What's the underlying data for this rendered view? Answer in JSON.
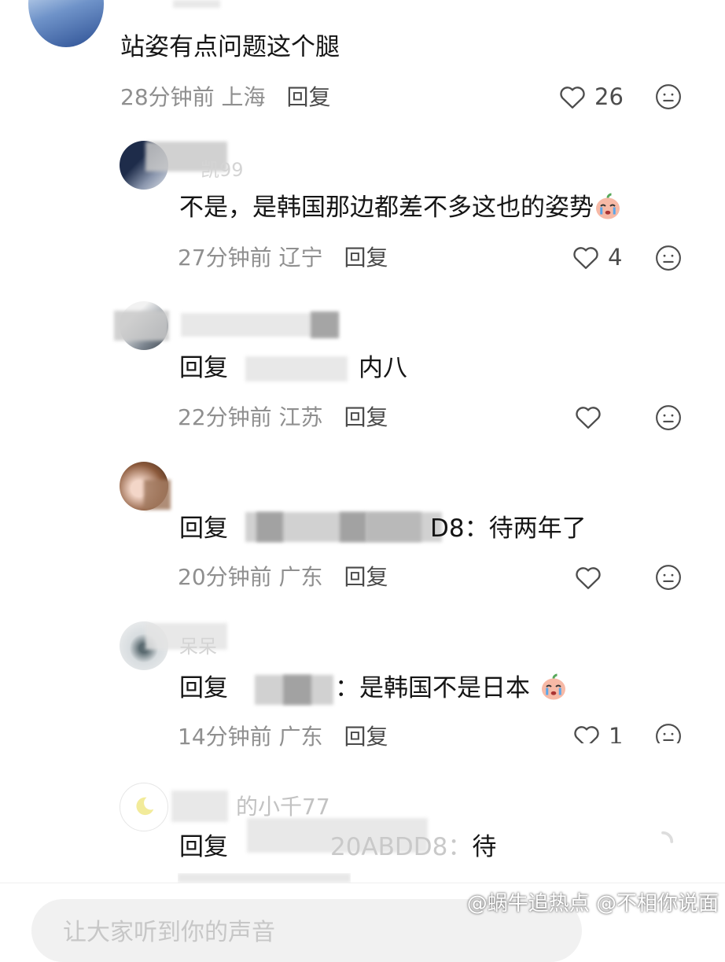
{
  "comments": [
    {
      "text": "站姿有点问题这个腿",
      "time": "28分钟前",
      "location": "上海",
      "reply": "回复",
      "likes": "26"
    },
    {
      "text": "不是，是韩国那边都差不多这也的姿势",
      "time": "27分钟前",
      "location": "辽宁",
      "reply": "回复",
      "likes": "4"
    },
    {
      "reply_prefix": "回复",
      "text": "内八",
      "time": "22分钟前",
      "location": "江苏",
      "reply": "回复",
      "likes": ""
    },
    {
      "reply_prefix": "回复",
      "target_visible": "D8：",
      "text": "待两年了",
      "time": "20分钟前",
      "location": "广东",
      "reply": "回复",
      "likes": ""
    },
    {
      "reply_prefix": "回复",
      "target_visible": "：",
      "text": "是韩国不是日本",
      "time": "14分钟前",
      "location": "广东",
      "reply": "回复",
      "likes": "1"
    },
    {
      "reply_prefix": "回复",
      "target_visible": "20ABDD8：",
      "text": "待",
      "name_visible": "的小千77"
    }
  ],
  "partial_name_2": "凯99",
  "partial_name_5": "呆呆",
  "input": {
    "placeholder": "让大家听到你的声音"
  },
  "watermark": "@蜗牛追热点 @不相你说面",
  "icons": {
    "like": "heart-outline-icon",
    "emoji": "crying-face-emoji-icon",
    "dislike": "meh-face-icon"
  }
}
